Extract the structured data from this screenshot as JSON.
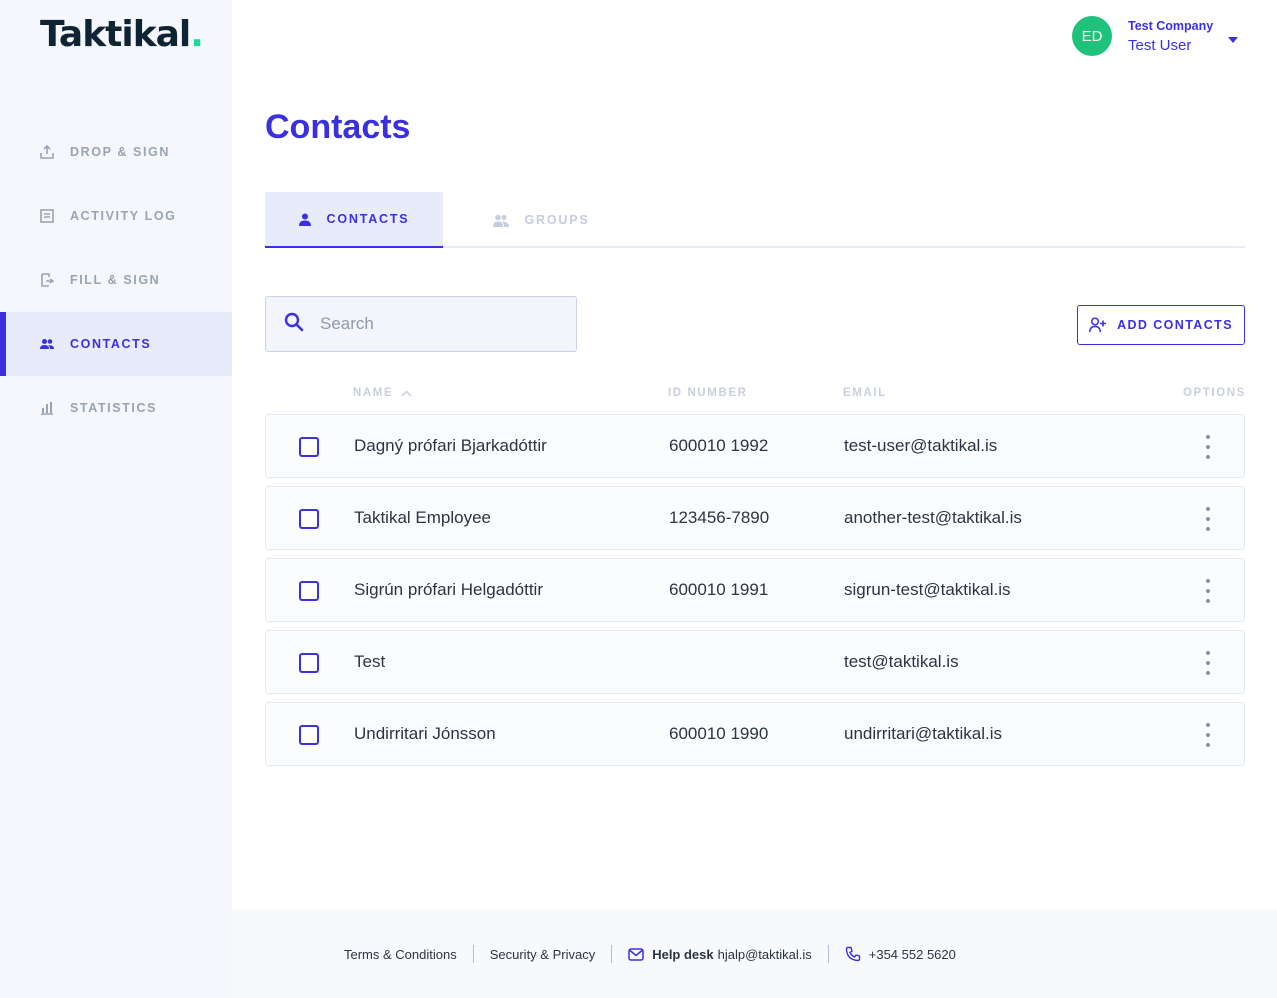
{
  "brand": {
    "logo_text": "Taktikal",
    "logo_dot": "."
  },
  "sidebar": {
    "items": [
      {
        "label": "DROP & SIGN",
        "icon": "upload-icon"
      },
      {
        "label": "ACTIVITY LOG",
        "icon": "log-icon"
      },
      {
        "label": "FILL & SIGN",
        "icon": "fill-sign-icon"
      },
      {
        "label": "CONTACTS",
        "icon": "people-icon",
        "active": true
      },
      {
        "label": "STATISTICS",
        "icon": "bar-chart-icon"
      }
    ]
  },
  "user": {
    "initials": "ED",
    "company": "Test Company",
    "name": "Test User"
  },
  "main": {
    "title": "Contacts",
    "tabs": [
      {
        "label": "CONTACTS",
        "active": true
      },
      {
        "label": "GROUPS",
        "active": false
      }
    ],
    "search": {
      "placeholder": "Search",
      "value": ""
    },
    "add_button": "ADD CONTACTS",
    "columns": {
      "name": "NAME",
      "id_number": "ID NUMBER",
      "email": "EMAIL",
      "options": "OPTIONS"
    },
    "rows": [
      {
        "name": "Dagný prófari Bjarkadóttir",
        "id_number": "600010 1992",
        "email": "test-user@taktikal.is"
      },
      {
        "name": "Taktikal Employee",
        "id_number": "123456-7890",
        "email": "another-test@taktikal.is"
      },
      {
        "name": "Sigrún prófari Helgadóttir",
        "id_number": "600010 1991",
        "email": "sigrun-test@taktikal.is"
      },
      {
        "name": "Test",
        "id_number": "",
        "email": "test@taktikal.is"
      },
      {
        "name": "Undirritari Jónsson",
        "id_number": "600010 1990",
        "email": "undirritari@taktikal.is"
      }
    ]
  },
  "footer": {
    "terms": "Terms & Conditions",
    "security": "Security & Privacy",
    "helpdesk_label": "Help desk",
    "helpdesk_email": "hjalp@taktikal.is",
    "phone": "+354 552 5620"
  },
  "colors": {
    "accent": "#3b30e0",
    "avatar": "#1fc27a",
    "logo_dot": "#1ed89a",
    "muted": "#9aa3b2"
  }
}
